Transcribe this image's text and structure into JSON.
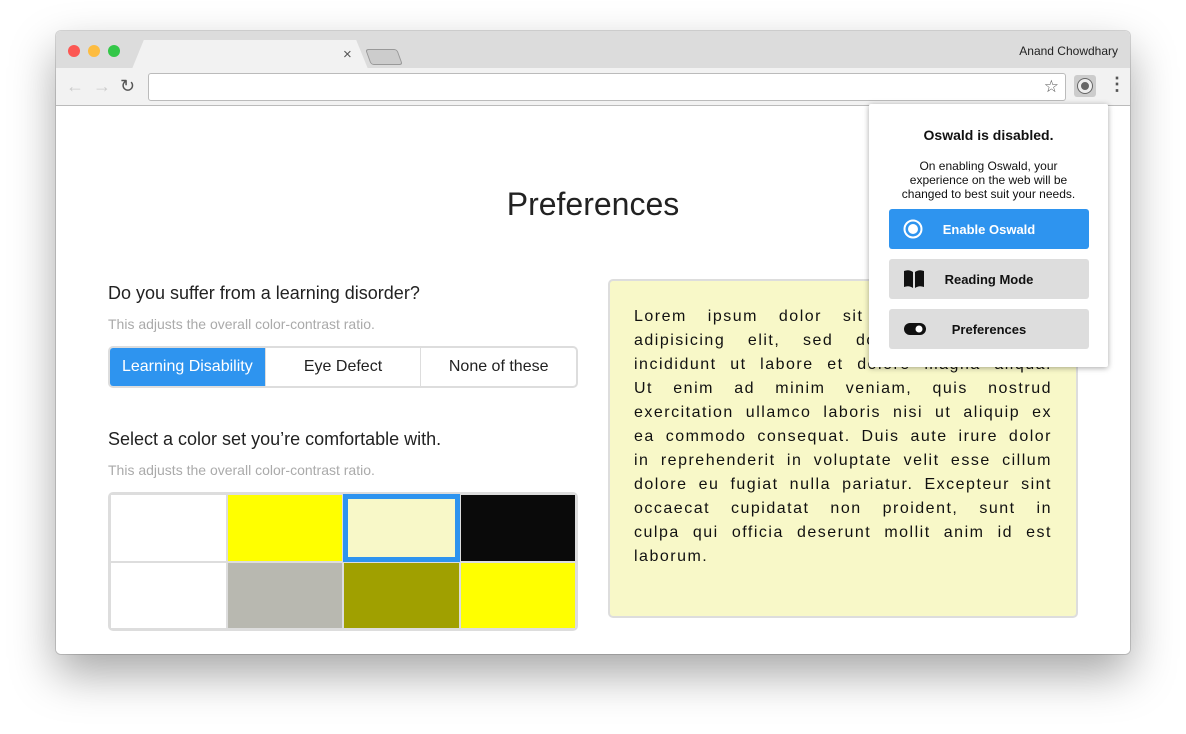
{
  "browser": {
    "user": "Anand Chowdhary",
    "tab_close": "×"
  },
  "page": {
    "title": "Preferences",
    "q1": {
      "question": "Do you suffer from a learning disorder?",
      "hint": "This adjusts the overall color-contrast ratio.",
      "options": [
        "Learning Disability",
        "Eye Defect",
        "None of these"
      ],
      "selected": 0
    },
    "q2": {
      "question": "Select a color set you’re comfortable with.",
      "hint": "This adjusts the overall color-contrast ratio.",
      "swatches": [
        "#ffffff",
        "#ffff00",
        "#f8f8c8",
        "#0a0a0a",
        "#ffffff",
        "#b8b8b0",
        "#a0a000",
        "#ffff00"
      ],
      "selected": 2
    },
    "sample_text": "Lorem ipsum dolor sit amet, consectetur adipisicing elit, sed do eiusmod tempor incididunt ut labore et dolore magna aliqua. Ut enim ad minim veniam, quis nostrud exercitation ullamco laboris nisi ut aliquip ex ea commodo consequat. Duis aute irure dolor in reprehenderit in voluptate velit esse cillum dolore eu fugiat nulla pariatur. Excepteur sint occaecat cupidatat non proident, sunt in culpa qui officia deserunt mollit anim id est laborum."
  },
  "popup": {
    "title": "Oswald is disabled.",
    "description": "On enabling Oswald, your experience on the web will be changed to best suit your needs.",
    "enable": "Enable Oswald",
    "reading": "Reading Mode",
    "prefs": "Preferences"
  },
  "colors": {
    "accent": "#2e94ef"
  }
}
